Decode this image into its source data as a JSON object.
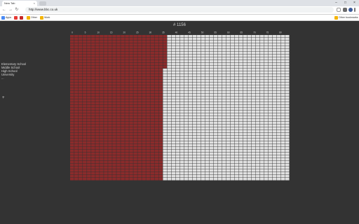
{
  "browser": {
    "tab_title": "New Tab",
    "tab_close": "×",
    "address": "http://www.bbc.co.uk",
    "nav": {
      "back": "←",
      "forward": "→",
      "reload": "↻"
    },
    "window_controls": {
      "minimize": "–",
      "maximize": "□",
      "close": "×"
    },
    "bookmarks": [
      {
        "label": "Apps",
        "color": "#4a8af4"
      },
      {
        "label": "",
        "color": "#e53935"
      },
      {
        "label": "",
        "color": "#c62828"
      },
      {
        "label": "Other",
        "color": "#f4b400"
      },
      {
        "label": "Work",
        "color": "#f4b400"
      }
    ],
    "other_bookmarks": "Other bookmarks"
  },
  "page": {
    "title": "# 1156",
    "legend": [
      "Elementary School",
      "Middle School",
      "High School",
      "University",
      "..."
    ],
    "add_button": "+"
  },
  "chart_data": {
    "type": "heatmap",
    "title": "# 1156",
    "columns": 52,
    "rows": 52,
    "x_tick_labels": [
      "0",
      "5",
      "10",
      "15",
      "20",
      "25",
      "30",
      "35",
      "40",
      "45",
      "50",
      "55",
      "60",
      "65",
      "70",
      "75",
      "80"
    ],
    "filled_cells": 1156,
    "total_cells": 2704,
    "colors": {
      "filled": "#8b2b2b",
      "empty": "#e0e0e0",
      "grid_line": "#333333"
    }
  }
}
